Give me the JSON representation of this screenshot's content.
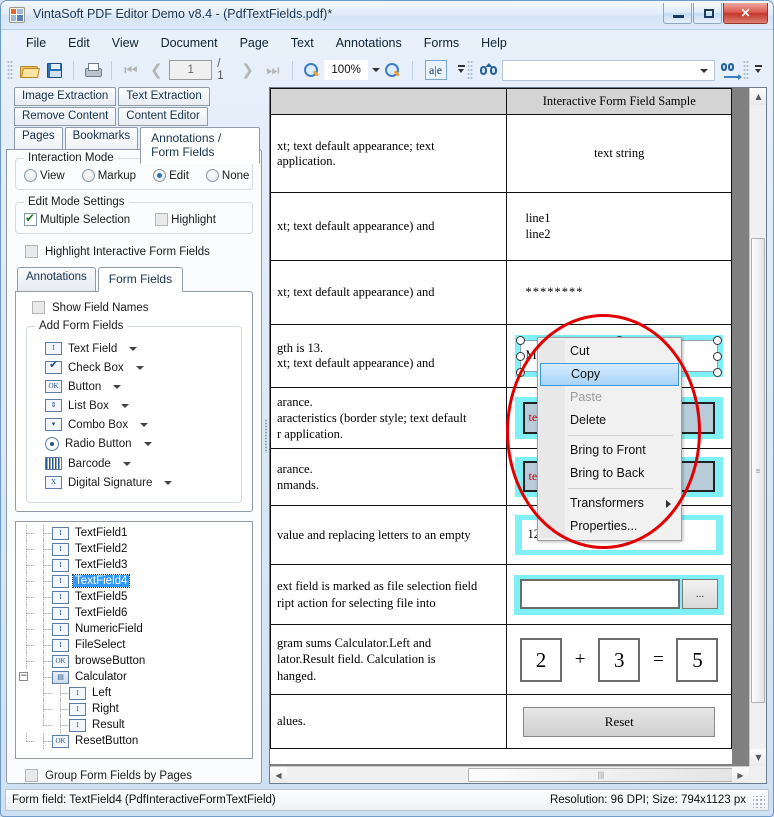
{
  "window": {
    "title": "VintaSoft PDF Editor Demo v8.4 -  (PdfTextFields.pdf)*",
    "minimize_label": "Minimize",
    "maximize_label": "Maximize",
    "close_label": "Close"
  },
  "menubar": {
    "items": [
      "File",
      "Edit",
      "View",
      "Document",
      "Page",
      "Text",
      "Annotations",
      "Forms",
      "Help"
    ]
  },
  "toolbar": {
    "open_label": "Open",
    "save_label": "Save",
    "print_label": "Print",
    "first_page_label": "|<",
    "prev_page_label": "<",
    "page_number": "1",
    "page_total": "/ 1",
    "next_page_label": ">",
    "last_page_label": ">|",
    "zoom_out_label": "Zoom out",
    "zoom_value": "100%",
    "zoom_in_label": "Zoom in",
    "text_tool_label": "a|e",
    "find_label": "Find",
    "find_value": "",
    "find_next_label": "Find next",
    "overflow_label": "More"
  },
  "leftpanel": {
    "tabs_row1": [
      "Image Extraction",
      "Text Extraction"
    ],
    "tabs_row2": [
      "Remove Content",
      "Content Editor"
    ],
    "tabs_row3": [
      "Pages",
      "Bookmarks",
      "Annotations / Form Fields"
    ],
    "selected_tab": "Annotations / Form Fields",
    "interaction_mode": {
      "legend": "Interaction Mode",
      "options": [
        "View",
        "Markup",
        "Edit",
        "None"
      ],
      "selected": "Edit"
    },
    "edit_mode_settings": {
      "legend": "Edit Mode Settings",
      "multiple_selection_label": "Multiple Selection",
      "multiple_selection_checked": true,
      "highlight_label": "Highlight",
      "highlight_checked": false
    },
    "highlight_form_fields_label": "Highlight Interactive Form  Fields",
    "highlight_form_fields_checked": false,
    "subtabs": [
      "Annotations",
      "Form Fields"
    ],
    "selected_subtab": "Form Fields",
    "show_field_names_label": "Show Field Names",
    "show_field_names_checked": false,
    "add_form_fields": {
      "legend": "Add Form Fields",
      "items": [
        {
          "label": "Text Field",
          "icon": "text-field-icon"
        },
        {
          "label": "Check Box",
          "icon": "check-box-icon"
        },
        {
          "label": "Button",
          "icon": "button-icon"
        },
        {
          "label": "List Box",
          "icon": "list-box-icon"
        },
        {
          "label": "Combo Box",
          "icon": "combo-box-icon"
        },
        {
          "label": "Radio Button",
          "icon": "radio-button-icon"
        },
        {
          "label": "Barcode",
          "icon": "barcode-icon"
        },
        {
          "label": "Digital Signature",
          "icon": "digital-signature-icon"
        }
      ]
    },
    "tree": {
      "nodes": [
        {
          "label": "TextField1",
          "icon": "text-field-icon",
          "depth": 1,
          "selected": false
        },
        {
          "label": "TextField2",
          "icon": "text-field-icon",
          "depth": 1,
          "selected": false
        },
        {
          "label": "TextField3",
          "icon": "text-field-icon",
          "depth": 1,
          "selected": false
        },
        {
          "label": "TextField4",
          "icon": "text-field-icon",
          "depth": 1,
          "selected": true
        },
        {
          "label": "TextField5",
          "icon": "text-field-icon",
          "depth": 1,
          "selected": false
        },
        {
          "label": "TextField6",
          "icon": "text-field-icon",
          "depth": 1,
          "selected": false
        },
        {
          "label": "NumericField",
          "icon": "text-field-icon",
          "depth": 1,
          "selected": false
        },
        {
          "label": "FileSelect",
          "icon": "text-field-icon",
          "depth": 1,
          "selected": false
        },
        {
          "label": "browseButton",
          "icon": "button-icon",
          "depth": 1,
          "selected": false
        },
        {
          "label": "Calculator",
          "icon": "group-icon",
          "depth": 0,
          "selected": false,
          "expander": "-"
        },
        {
          "label": "Left",
          "icon": "text-field-icon",
          "depth": 2,
          "selected": false
        },
        {
          "label": "Right",
          "icon": "text-field-icon",
          "depth": 2,
          "selected": false
        },
        {
          "label": "Result",
          "icon": "text-field-icon",
          "depth": 2,
          "selected": false
        },
        {
          "label": "ResetButton",
          "icon": "button-icon",
          "depth": 1,
          "selected": false
        }
      ]
    },
    "group_by_pages_label": "Group Form Fields by Pages",
    "group_by_pages_checked": false
  },
  "document": {
    "header_left": "",
    "header_right": "Interactive Form Field Sample",
    "rows": [
      {
        "desc": "xt; text default appearance; text\napplication.",
        "value": "text string",
        "kind": "text"
      },
      {
        "desc": "xt; text default appearance) and",
        "value": "line1\nline2",
        "kind": "multiline"
      },
      {
        "desc": "xt; text default appearance) and",
        "value": "********",
        "kind": "password"
      },
      {
        "desc": "gth is 13.\nxt; text default appearance) and",
        "value": "Ma",
        "kind": "selected-comb"
      },
      {
        "desc": "arance.\naracteristics (border style; text default\nr application.",
        "value": "text",
        "kind": "styled1"
      },
      {
        "desc": "arance.\nnmands.",
        "value": "text",
        "kind": "styled2"
      },
      {
        "desc": "value and replacing letters to an empty",
        "value": "12345",
        "kind": "numeric"
      },
      {
        "desc": "ext field is marked as file selection field\nript action for selecting file into",
        "value": "",
        "kind": "fileselect",
        "browse_label": "..."
      },
      {
        "desc": "gram sums Calculator.Left and\nlator.Result field. Calculation is\nhanged.",
        "kind": "calculator",
        "left": "2",
        "op1": "+",
        "right": "3",
        "op2": "=",
        "result": "5"
      },
      {
        "desc": "alues.",
        "kind": "reset",
        "reset_label": "Reset"
      }
    ]
  },
  "context_menu": {
    "items": [
      {
        "label": "Cut",
        "state": "normal"
      },
      {
        "label": "Copy",
        "state": "selected"
      },
      {
        "label": "Paste",
        "state": "disabled"
      },
      {
        "label": "Delete",
        "state": "normal"
      },
      {
        "label": "-",
        "state": "separator"
      },
      {
        "label": "Bring to Front",
        "state": "normal"
      },
      {
        "label": "Bring to Back",
        "state": "normal"
      },
      {
        "label": "-",
        "state": "separator"
      },
      {
        "label": "Transformers",
        "state": "submenu"
      },
      {
        "label": "Properties...",
        "state": "normal"
      }
    ]
  },
  "annotation": {
    "shape": "red-ellipse",
    "color": "#e10000"
  },
  "statusbar": {
    "left": "Form field: TextField4 (PdfInteractiveFormTextField)",
    "right": "Resolution: 96 DPI; Size: 794x1123 px"
  }
}
